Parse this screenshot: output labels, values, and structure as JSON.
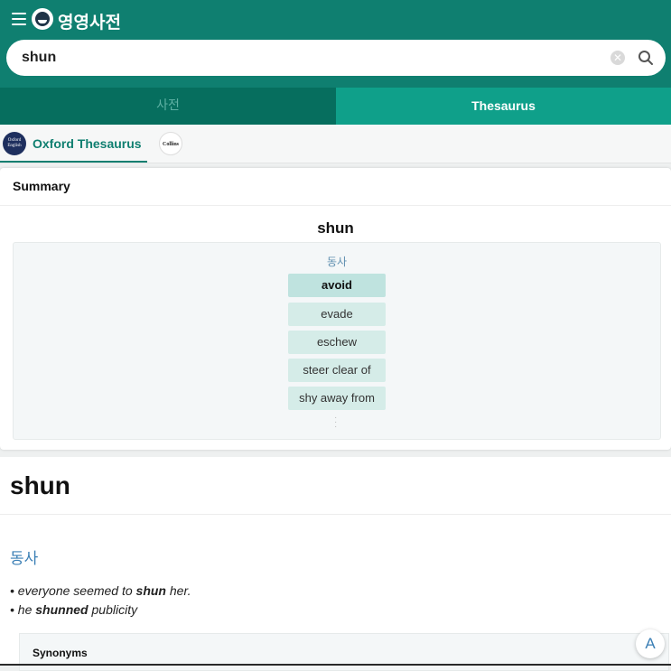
{
  "app": {
    "title": "영영사전",
    "menu_icon": "hamburger-icon",
    "logo_icon": "app-logo-icon"
  },
  "search": {
    "query": "shun",
    "clear_icon": "clear-icon",
    "search_icon": "search-icon"
  },
  "tabs": [
    {
      "label": "사전",
      "active": false
    },
    {
      "label": "Thesaurus",
      "active": true
    }
  ],
  "sources": {
    "oxford": {
      "label": "Oxford Thesaurus",
      "logo_text": "Oxford English",
      "active": true
    },
    "collins": {
      "logo_text": "Collins",
      "active": false
    }
  },
  "summary": {
    "title": "Summary",
    "word": "shun",
    "pos": "동사",
    "synonyms": [
      "avoid",
      "evade",
      "eschew",
      "steer clear of",
      "shy away from"
    ]
  },
  "entry": {
    "word": "shun",
    "pos": "동사",
    "examples": [
      {
        "before": "everyone seemed to ",
        "bold": "shun",
        "after": " her."
      },
      {
        "before": "he ",
        "bold": "shunned",
        "after": " publicity"
      }
    ],
    "synonyms_label": "Synonyms"
  },
  "fab": {
    "label": "A"
  },
  "colors": {
    "primary": "#0f7f70",
    "tab_active": "#0fa08a",
    "tab_inactive": "#066e5e",
    "link_blue": "#3b7fb5"
  }
}
